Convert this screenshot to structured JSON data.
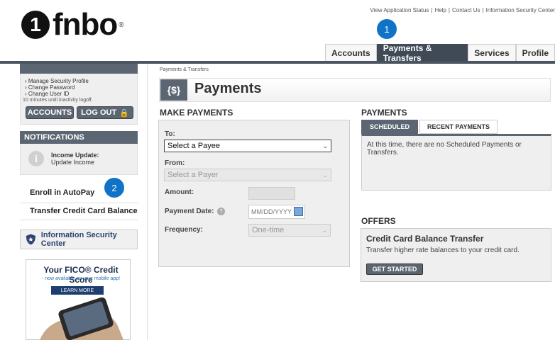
{
  "header": {
    "logo_mark": "1",
    "logo_text": "fnbo",
    "logo_reg": "®",
    "top_links": [
      "View Application Status",
      "Help",
      "Contact Us",
      "Information Security Center"
    ],
    "tabs": [
      {
        "label": "Accounts",
        "active": false
      },
      {
        "label": "Payments & Transfers",
        "active": true
      },
      {
        "label": "Services",
        "active": false
      },
      {
        "label": "Profile",
        "active": false
      }
    ],
    "badge1": "1"
  },
  "sidebar": {
    "profile_links": [
      "Manage Security Profile",
      "Change Password",
      "Change User ID"
    ],
    "timeout_text": "10 minutes until inactivity logoff.",
    "accounts_button": "ACCOUNTS",
    "logout_button": "LOG OUT",
    "notifications_title": "NOTIFICATIONS",
    "notification_title": "Income Update:",
    "notification_text": "Update Income",
    "badge2": "2",
    "links": [
      "Enroll in AutoPay",
      "Transfer Credit Card Balance"
    ],
    "isc_label": "Information Security Center",
    "fico_title": "Your FICO® Credit Score",
    "fico_sub": "- now available on your mobile app!",
    "fico_learn": "LEARN MORE"
  },
  "main": {
    "breadcrumb": "Payments & Transfers",
    "title_icon": "{$}",
    "title": "Payments",
    "make_payments": {
      "heading": "MAKE PAYMENTS",
      "to_label": "To:",
      "payee_value": "Select a Payee",
      "from_label": "From:",
      "payer_placeholder": "Select a Payer",
      "amount_label": "Amount:",
      "date_label": "Payment Date:",
      "date_placeholder": "MM/DD/YYYY",
      "freq_label": "Frequency:",
      "freq_value": "One-time"
    },
    "payments": {
      "heading": "PAYMENTS",
      "tab_scheduled": "SCHEDULED",
      "tab_recent": "RECENT PAYMENTS",
      "empty_text": "At this time, there are no Scheduled Payments or Transfers."
    },
    "offers": {
      "heading": "OFFERS",
      "title": "Credit Card Balance Transfer",
      "desc": "Transfer higher rate balances to your credit card.",
      "button": "GET STARTED"
    }
  },
  "colors": {
    "accent_dark": "#5c6673",
    "badge_blue": "#1173c7"
  }
}
